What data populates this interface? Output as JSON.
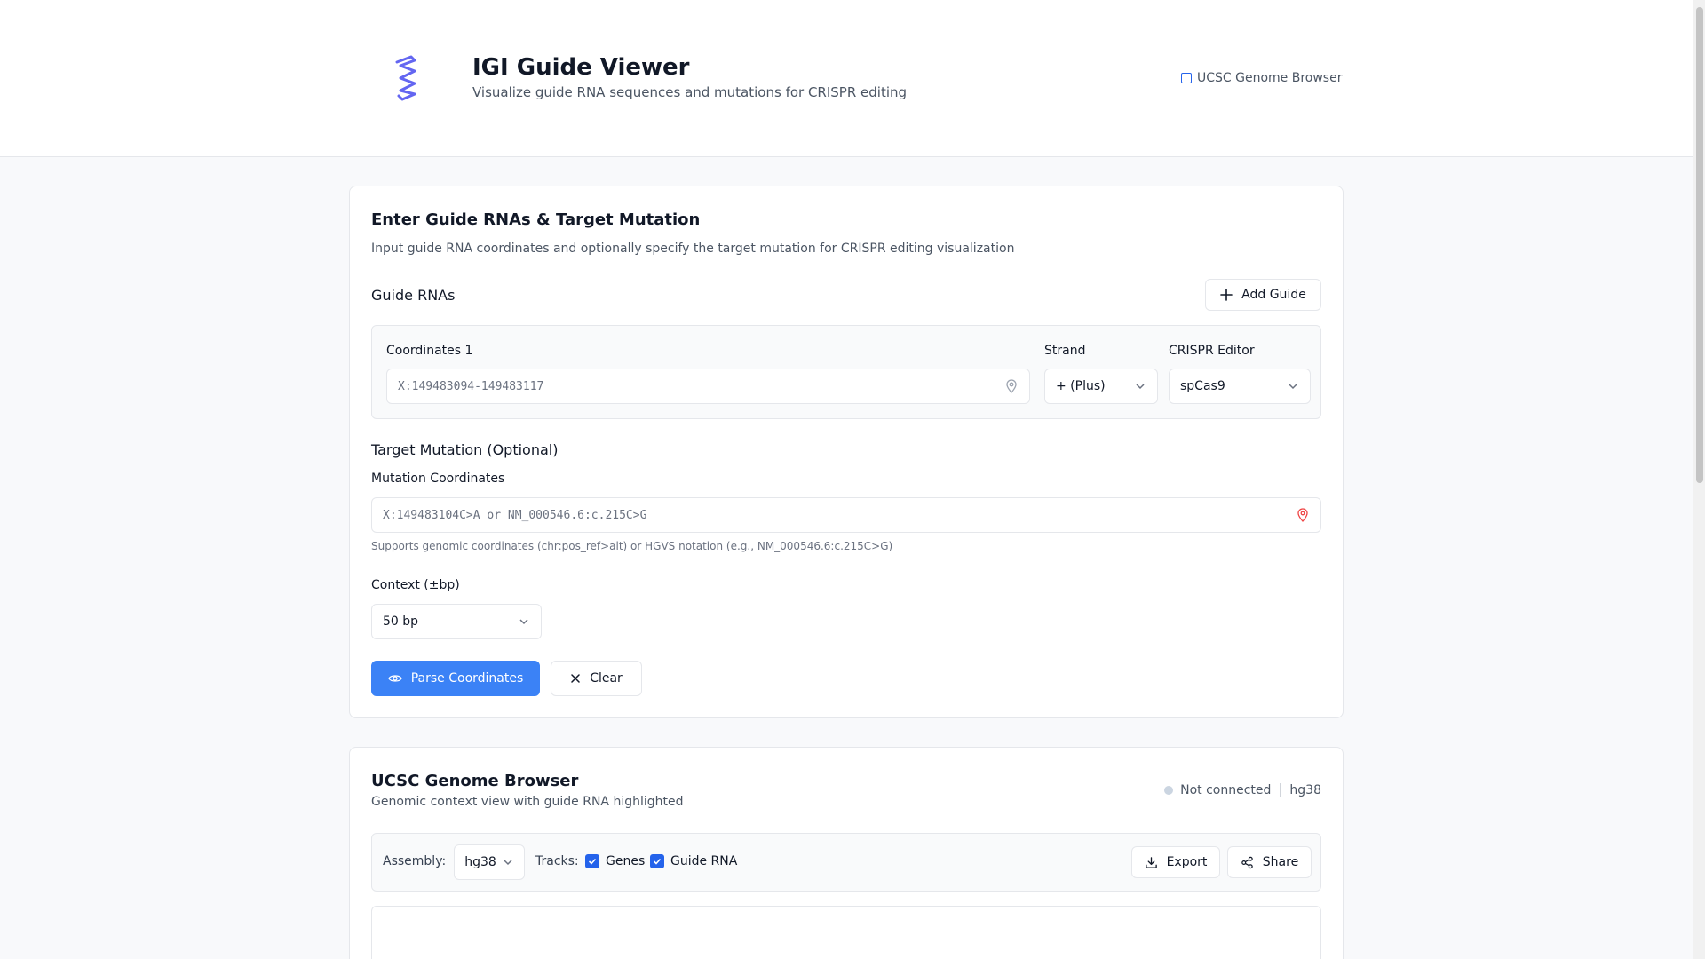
{
  "header": {
    "title": "IGI Guide Viewer",
    "subtitle": "Visualize guide RNA sequences and mutations for CRISPR editing",
    "external_link": "UCSC Genome Browser"
  },
  "input_card": {
    "title": "Enter Guide RNAs & Target Mutation",
    "description": "Input guide RNA coordinates and optionally specify the target mutation for CRISPR editing visualization",
    "guides_label": "Guide RNAs",
    "add_guide_label": "Add Guide",
    "guide": {
      "coordinates_label": "Coordinates 1",
      "coordinates_placeholder": "X:149483094-149483117",
      "strand_label": "Strand",
      "strand_value": "+ (Plus)",
      "editor_label": "CRISPR Editor",
      "editor_value": "spCas9"
    },
    "mutation": {
      "section_label": "Target Mutation (Optional)",
      "field_label": "Mutation Coordinates",
      "placeholder": "X:149483104C>A or NM_000546.6:c.215C>G",
      "help": "Supports genomic coordinates (chr:pos_ref>alt) or HGVS notation (e.g., NM_000546.6:c.215C>G)"
    },
    "context": {
      "label": "Context (±bp)",
      "value": "50 bp"
    },
    "parse_label": "Parse Coordinates",
    "clear_label": "Clear"
  },
  "browser_card": {
    "title": "UCSC Genome Browser",
    "description": "Genomic context view with guide RNA highlighted",
    "status": "Not connected",
    "assembly_badge": "hg38",
    "toolbar": {
      "assembly_label": "Assembly:",
      "assembly_value": "hg38",
      "tracks_label": "Tracks:",
      "track_genes": "Genes",
      "track_guide": "Guide RNA",
      "export_label": "Export",
      "share_label": "Share"
    }
  },
  "colors": {
    "accent": "#3b82f6",
    "logo": "#6366f1",
    "pin_red": "#ef4444",
    "status_dot": "#cbd5e1"
  },
  "icons": [
    "dna-logo-icon",
    "external-link-icon",
    "plus-icon",
    "map-pin-icon",
    "chevron-down-icon",
    "eye-icon",
    "x-icon",
    "check-icon",
    "download-icon",
    "share-icon"
  ]
}
